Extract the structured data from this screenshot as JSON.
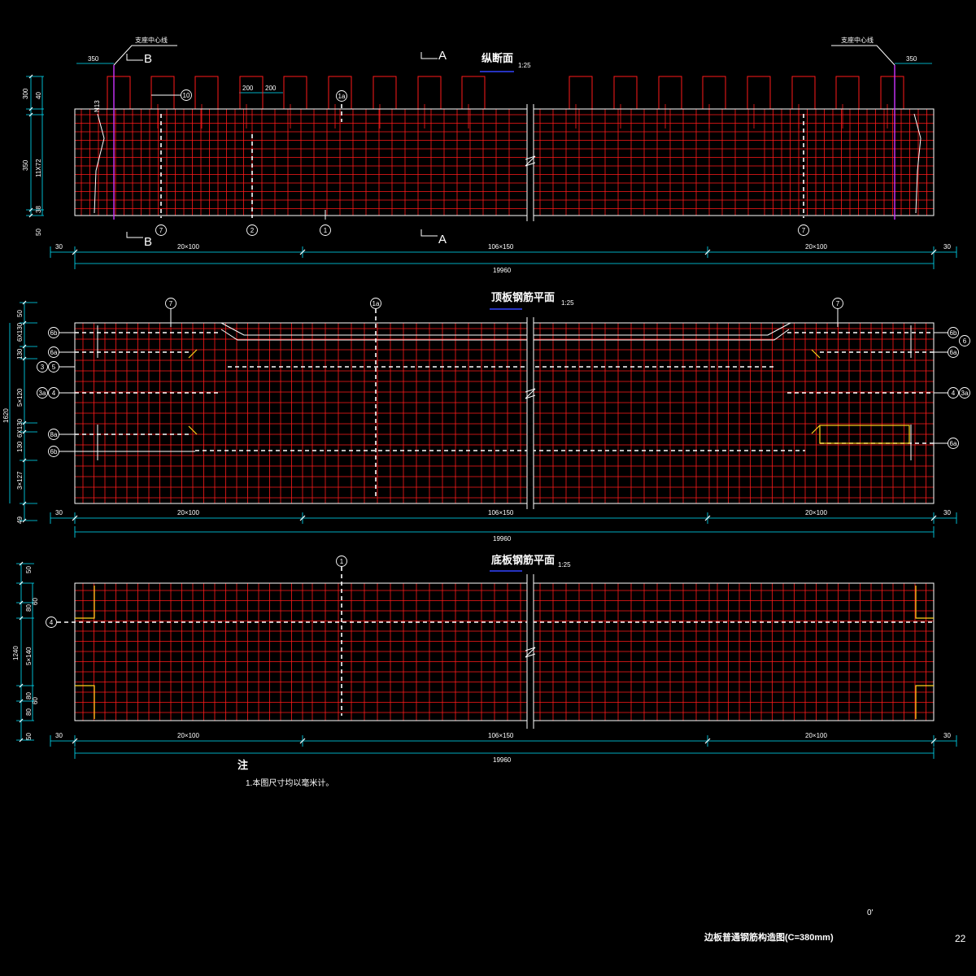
{
  "colors": {
    "rebar": "#ff1a1a",
    "outline": "#ffffff",
    "dim": "#00e5ff",
    "centerline": "#cc33ff",
    "title_underline": "#3344ff",
    "accent": "#ffd21a",
    "background": "#000000"
  },
  "section1": {
    "title": "纵断面",
    "scale": "1:25",
    "support_left": "支座中心线",
    "support_right": "支座中心线",
    "dim_350_left": "350",
    "dim_350_right": "350",
    "dim_200a": "200",
    "dim_200b": "200",
    "cut_b": "B",
    "cut_a": "A",
    "n13": "N13",
    "v_dims": [
      "300",
      "40",
      "350",
      "11X72",
      "38",
      "50"
    ],
    "markers": [
      "10",
      "1a",
      "7",
      "2",
      "1",
      "7"
    ],
    "h_dims": [
      "30",
      "20×100",
      "106×150",
      "20×100",
      "30"
    ],
    "total": "19960"
  },
  "section2": {
    "title": "顶板钢筋平面",
    "scale": "1:25",
    "v_dims": [
      "50",
      "1620",
      "130",
      "6X130",
      "5×120",
      "130",
      "6X130",
      "3×127",
      "49"
    ],
    "left_labels": [
      "6b",
      "6a",
      "3",
      "5",
      "3a",
      "4",
      "8a",
      "6b"
    ],
    "right_labels": [
      "6b",
      "6",
      "6a",
      "4",
      "3a",
      "6a"
    ],
    "top_markers": [
      "7",
      "1a",
      "7"
    ],
    "h_dims": [
      "30",
      "20×100",
      "106×150",
      "20×100",
      "30"
    ],
    "total": "19960"
  },
  "section3": {
    "title": "底板钢筋平面",
    "scale": "1:25",
    "v_dims": [
      "50",
      "1240",
      "80",
      "60",
      "5×140",
      "80",
      "60",
      "80",
      "50"
    ],
    "left_label": "4",
    "top_marker": "1",
    "h_dims": [
      "30",
      "20×100",
      "106×150",
      "20×100",
      "30"
    ],
    "total": "19960"
  },
  "notes": {
    "heading": "注",
    "line1": "1.本图尺寸均以毫米计。"
  },
  "footer": {
    "title": "边板普通钢筋构造图(C=380mm)",
    "page": "22",
    "mark": "0'"
  }
}
